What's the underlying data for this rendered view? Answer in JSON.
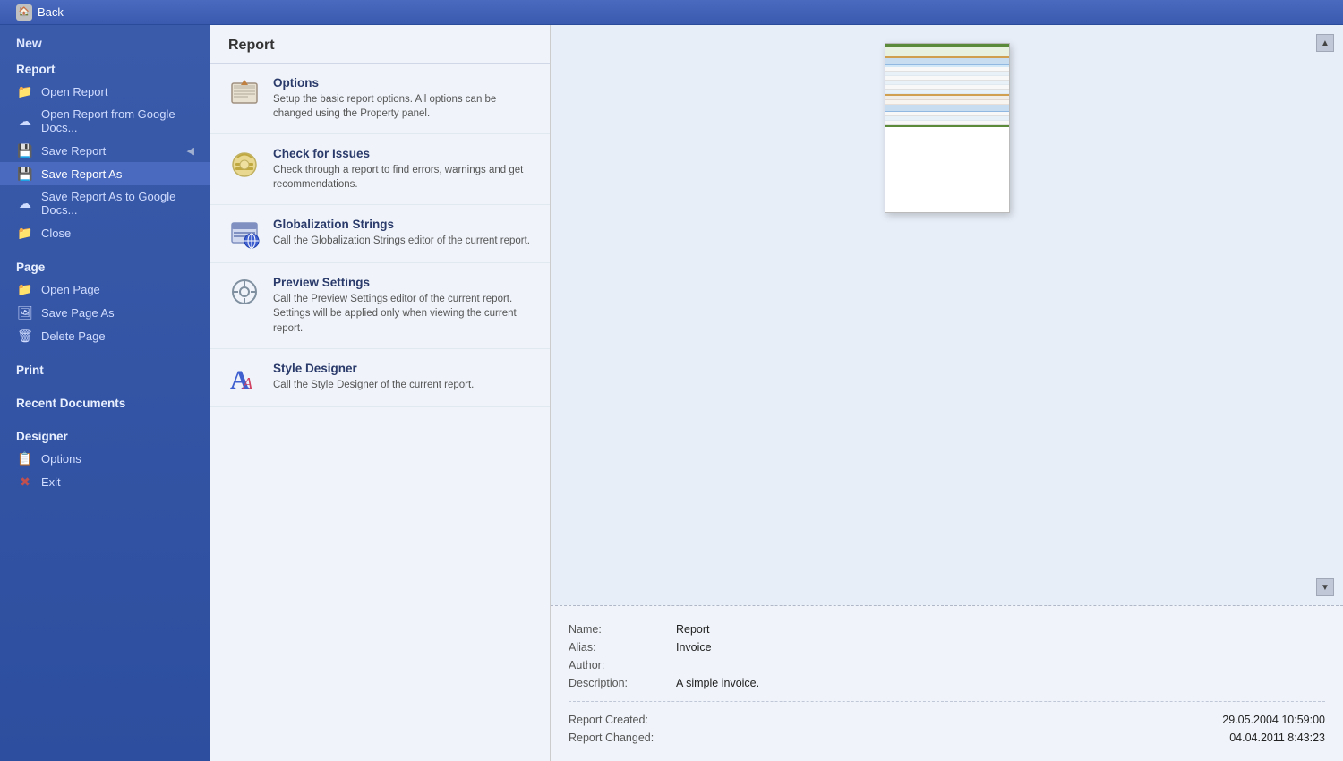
{
  "topbar": {
    "back_label": "Back"
  },
  "sidebar": {
    "new_label": "New",
    "report_section": "Report",
    "items_report": [
      {
        "id": "open-report",
        "label": "Open Report",
        "icon": "📁"
      },
      {
        "id": "open-report-google",
        "label": "Open Report from Google Docs...",
        "icon": "☁"
      },
      {
        "id": "save-report",
        "label": "Save Report",
        "icon": "💾"
      },
      {
        "id": "save-report-as",
        "label": "Save Report As",
        "icon": "💾",
        "active": true
      },
      {
        "id": "save-report-google",
        "label": "Save Report As to Google Docs...",
        "icon": "☁"
      },
      {
        "id": "close",
        "label": "Close",
        "icon": "📁"
      }
    ],
    "page_section": "Page",
    "items_page": [
      {
        "id": "open-page",
        "label": "Open Page",
        "icon": "📁"
      },
      {
        "id": "save-page-as",
        "label": "Save Page As",
        "icon": "🖼"
      },
      {
        "id": "delete-page",
        "label": "Delete Page",
        "icon": "🗑"
      }
    ],
    "print_section": "Print",
    "recent_section": "Recent Documents",
    "designer_section": "Designer",
    "items_designer": [
      {
        "id": "options",
        "label": "Options",
        "icon": "📋"
      },
      {
        "id": "exit",
        "label": "Exit",
        "icon": "✖"
      }
    ]
  },
  "report_panel": {
    "title": "Report",
    "menu_items": [
      {
        "id": "options",
        "title": "Options",
        "desc": "Setup the basic report options. All options can be changed using the Property panel.",
        "icon": "options"
      },
      {
        "id": "check-issues",
        "title": "Check for Issues",
        "desc": "Check through a report to find errors, warnings and get recommendations.",
        "icon": "check"
      },
      {
        "id": "globalization",
        "title": "Globalization Strings",
        "desc": "Call the Globalization Strings editor of the current report.",
        "icon": "globe"
      },
      {
        "id": "preview-settings",
        "title": "Preview Settings",
        "desc": "Call the Preview Settings editor of the current report. Settings will be applied only when viewing the current report.",
        "icon": "preview"
      },
      {
        "id": "style-designer",
        "title": "Style Designer",
        "desc": "Call the Style Designer of the current report.",
        "icon": "style"
      }
    ]
  },
  "preview": {
    "scroll_up": "▲",
    "scroll_down": "▼"
  },
  "info": {
    "name_label": "Name:",
    "name_value": "Report",
    "alias_label": "Alias:",
    "alias_value": "Invoice",
    "author_label": "Author:",
    "author_value": "",
    "description_label": "Description:",
    "description_value": "A simple invoice.",
    "created_label": "Report Created:",
    "created_value": "29.05.2004 10:59:00",
    "changed_label": "Report Changed:",
    "changed_value": "04.04.2011 8:43:23"
  }
}
